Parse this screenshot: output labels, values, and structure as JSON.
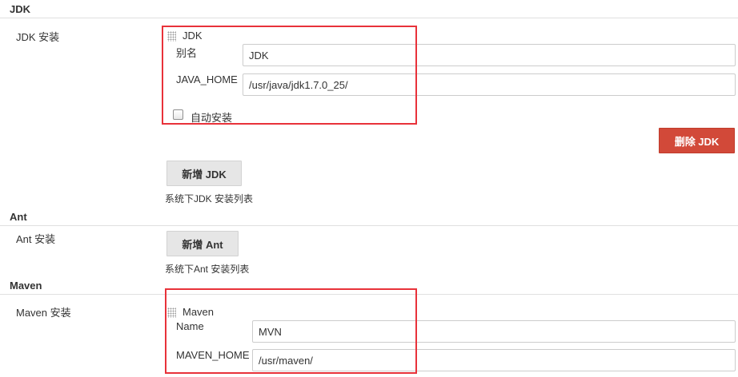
{
  "jdk": {
    "section_title": "JDK",
    "install_label": "JDK 安装",
    "block_title": "JDK",
    "alias_label": "别名",
    "alias_value": "JDK",
    "home_label": "JAVA_HOME",
    "home_value": "/usr/java/jdk1.7.0_25/",
    "auto_install_label": "自动安装",
    "auto_install_checked": false,
    "delete_button": "删除 JDK",
    "add_button": "新增 JDK",
    "help_text": "系统下JDK 安装列表"
  },
  "ant": {
    "section_title": "Ant",
    "install_label": "Ant 安装",
    "add_button": "新增 Ant",
    "help_text": "系统下Ant 安装列表"
  },
  "maven": {
    "section_title": "Maven",
    "install_label": "Maven 安装",
    "block_title": "Maven",
    "name_label": "Name",
    "name_value": "MVN",
    "home_label": "MAVEN_HOME",
    "home_value": "/usr/maven/"
  },
  "colors": {
    "highlight": "#e8323a",
    "delete_button": "#d24939",
    "add_button": "#e6e6e6"
  },
  "icons": {
    "drag_handle": "grip-dots-icon"
  }
}
